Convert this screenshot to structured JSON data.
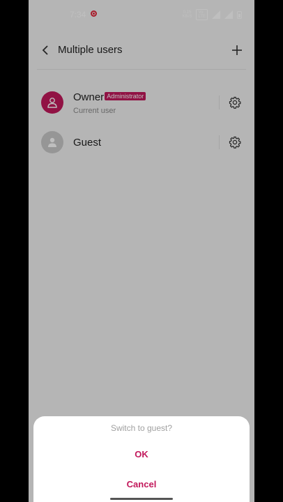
{
  "status_bar": {
    "time": "7:34",
    "net_speed_value": "0.15",
    "net_speed_unit": "KB/S",
    "volte_line1": "Vo",
    "volte_line2": "LTE"
  },
  "header": {
    "title": "Multiple users"
  },
  "users": [
    {
      "name": "Owner",
      "badge": "Administrator",
      "subtitle": "Current user"
    },
    {
      "name": "Guest"
    }
  ],
  "dialog": {
    "title": "Switch to guest?",
    "ok_label": "OK",
    "cancel_label": "Cancel"
  },
  "colors": {
    "accent": "#c2185b",
    "owner_avatar": "#c2185b",
    "guest_avatar": "#c8c8c8",
    "record_dot": "#e0263a"
  },
  "icons": {
    "back": "chevron-left-icon",
    "add": "plus-icon",
    "settings": "gear-icon",
    "avatar": "person-icon"
  }
}
